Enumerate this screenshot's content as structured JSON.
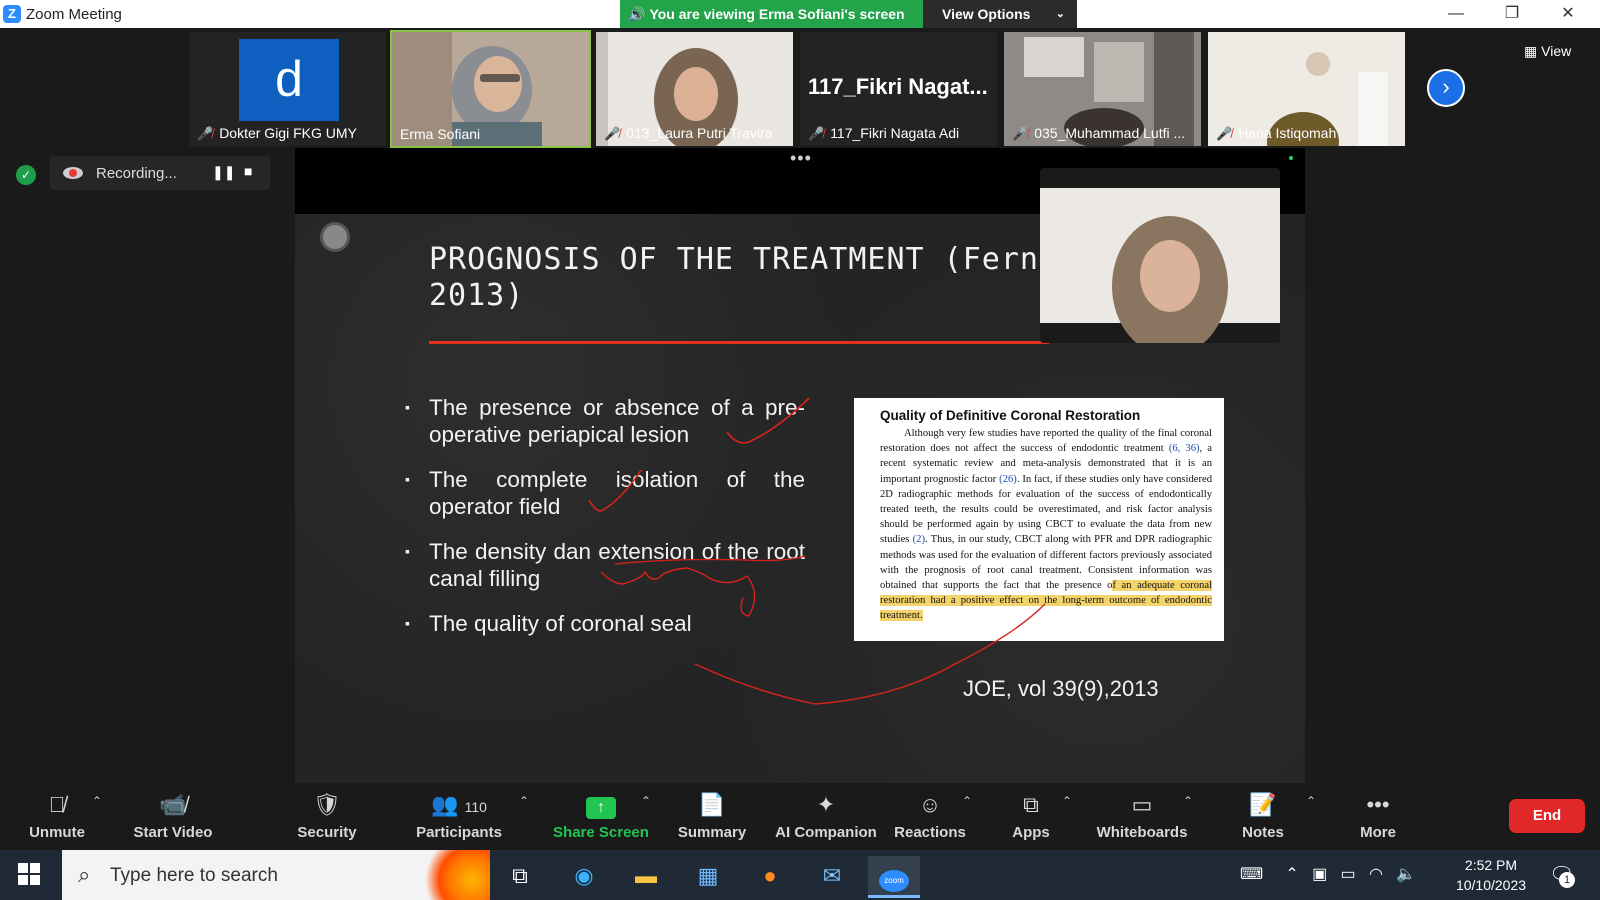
{
  "window": {
    "title": "Zoom Meeting",
    "app_logo": "Z",
    "viewing_banner": "You are viewing Erma Sofiani's screen",
    "view_options": "View Options",
    "minimize": "—",
    "restore": "❐",
    "close": "✕"
  },
  "gallery": {
    "participants": [
      {
        "name": "Dokter Gigi FKG UMY",
        "avatar_letter": "d",
        "muted": true
      },
      {
        "name": "Erma Sofiani",
        "muted": false,
        "active": true
      },
      {
        "name": "013_Laura Putri Travira",
        "muted": true
      },
      {
        "name": "117_Fikri Nagata Adi",
        "big_label": "117_Fikri  Nagat...",
        "muted": true
      },
      {
        "name": "035_Muhammad Lutfi ...",
        "muted": true
      },
      {
        "name": "Hana Istiqomah",
        "muted": true
      }
    ],
    "view_label": "View"
  },
  "recording": {
    "label": "Recording...",
    "pause_icon": "❚❚",
    "stop_icon": "■"
  },
  "share": {
    "more_dots": "•••"
  },
  "slide": {
    "title_line1": "PROGNOSIS OF THE TREATMENT (Fernan",
    "title_line2": "2013)",
    "bullets": [
      "The presence or absence of a pre-operative periapical lesion",
      "The complete isolation of the operator field",
      "The density dan extension of the root canal filling",
      "The quality of coronal seal"
    ],
    "paper": {
      "heading": "Quality of Definitive Coronal Restoration",
      "text_a": "Although very few studies have reported the quality of the final coronal restoration does not affect the success of endodontic treatment ",
      "cite_a": "(6, 36)",
      "text_b": ", a recent systematic review and meta-analysis demonstrated that it is an important prognostic factor ",
      "cite_b": "(26)",
      "text_c": ". In fact, if these studies only have considered 2D radiographic methods for evaluation of the success of endodontically treated teeth, the results could be overestimated, and risk factor analysis should be performed again by using CBCT to evaluate the data from new studies ",
      "cite_c": "(2)",
      "text_d": ". Thus, in our study, CBCT along with PFR and DPR radiographic methods was used for the evaluation of different factors previously associated with the prognosis of root canal treatment. Consistent information was obtained that supports the fact that the presence o",
      "highlight": "f an adequate coronal restoration had a positive effect on the long-term outcome of endodontic treatment."
    },
    "journal_ref": "JOE, vol 39(9),2013",
    "annotation_color": "#d8231b"
  },
  "toolbar": {
    "items": [
      {
        "key": "unmute",
        "label": "Unmute",
        "icon": "mic-off-icon"
      },
      {
        "key": "start_video",
        "label": "Start Video",
        "icon": "video-off-icon"
      },
      {
        "key": "security",
        "label": "Security",
        "icon": "shield-icon"
      },
      {
        "key": "participants",
        "label": "Participants",
        "icon": "participants-icon",
        "count": "110"
      },
      {
        "key": "share_screen",
        "label": "Share Screen",
        "icon": "share-screen-icon"
      },
      {
        "key": "summary",
        "label": "Summary",
        "icon": "summary-icon"
      },
      {
        "key": "ai_companion",
        "label": "AI Companion",
        "icon": "sparkle-icon"
      },
      {
        "key": "reactions",
        "label": "Reactions",
        "icon": "emoji-icon"
      },
      {
        "key": "apps",
        "label": "Apps",
        "icon": "apps-icon"
      },
      {
        "key": "whiteboards",
        "label": "Whiteboards",
        "icon": "whiteboard-icon"
      },
      {
        "key": "notes",
        "label": "Notes",
        "icon": "notes-icon"
      },
      {
        "key": "more",
        "label": "More",
        "icon": "more-icon"
      }
    ],
    "end_label": "End",
    "share_color": "#23c552",
    "end_color": "#e02828"
  },
  "taskbar": {
    "search_placeholder": "Type here to search",
    "time": "2:52 PM",
    "date": "10/10/2023",
    "notification_count": "1",
    "zoom_app_label": "zoom"
  }
}
